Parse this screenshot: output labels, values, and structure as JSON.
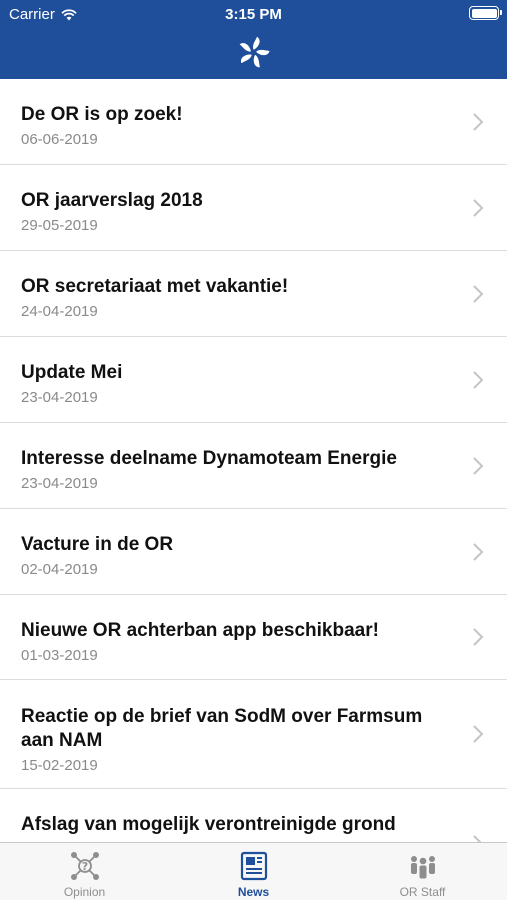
{
  "status_bar": {
    "carrier": "Carrier",
    "time": "3:15 PM"
  },
  "news": [
    {
      "title": "De OR is op zoek!",
      "date": "06-06-2019"
    },
    {
      "title": "OR jaarverslag 2018",
      "date": "29-05-2019"
    },
    {
      "title": "OR secretariaat met vakantie!",
      "date": "24-04-2019"
    },
    {
      "title": "Update Mei",
      "date": "23-04-2019"
    },
    {
      "title": "Interesse deelname Dynamoteam Energie",
      "date": "23-04-2019"
    },
    {
      "title": "Vacture in de OR",
      "date": "02-04-2019"
    },
    {
      "title": "Nieuwe OR achterban app beschikbaar!",
      "date": "01-03-2019"
    },
    {
      "title": "Reactie op de brief van SodM over Farmsum aan NAM",
      "date": "15-02-2019"
    },
    {
      "title": "Afslag van mogelijk verontreinigde grond",
      "date": ""
    }
  ],
  "tabs": [
    {
      "label": "Opinion",
      "icon": "opinion-network-icon",
      "active": false
    },
    {
      "label": "News",
      "icon": "newspaper-icon",
      "active": true
    },
    {
      "label": "OR Staff",
      "icon": "people-icon",
      "active": false
    }
  ],
  "colors": {
    "nav_blue": "#1f4f9a",
    "tab_inactive": "#8e8e8e"
  }
}
